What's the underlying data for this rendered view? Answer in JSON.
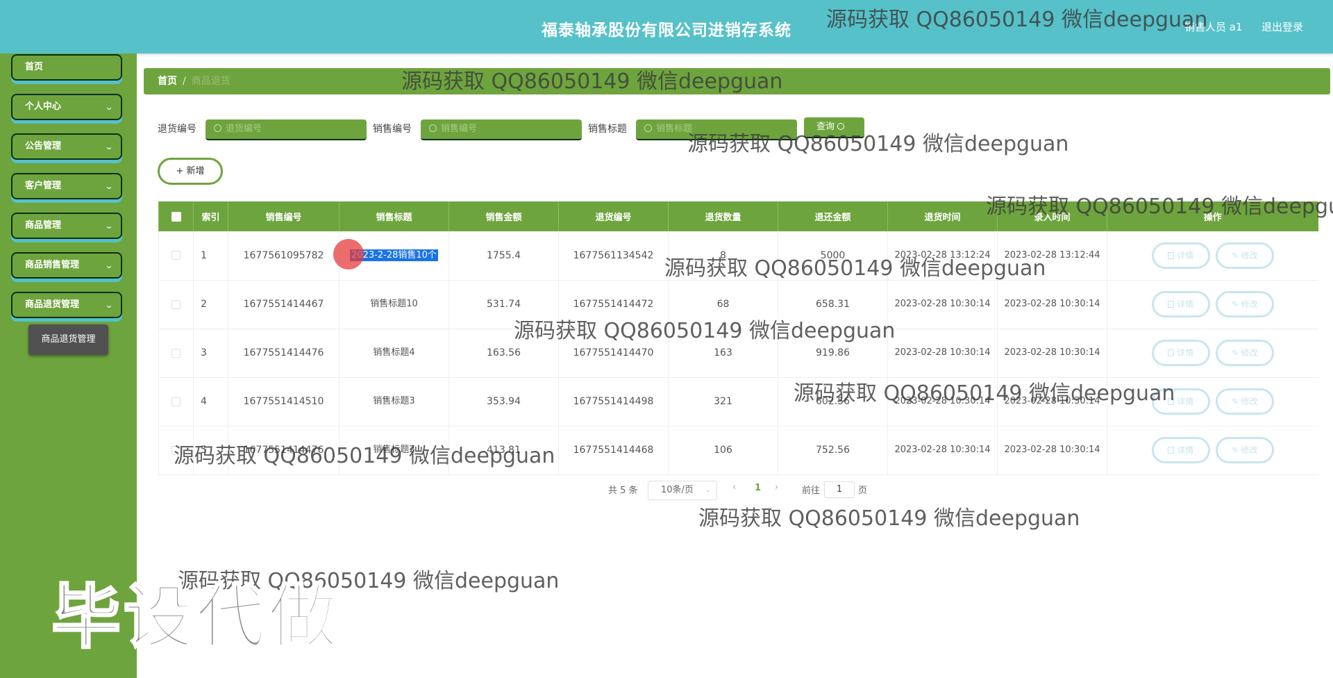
{
  "header": {
    "title": "福泰轴承股份有限公司进销存系统",
    "user_label": "销售人员 a1",
    "logout_label": "退出登录"
  },
  "sidebar": {
    "items": [
      {
        "label": "首页",
        "has_arrow": false
      },
      {
        "label": "个人中心",
        "has_arrow": true
      },
      {
        "label": "公告管理",
        "has_arrow": true
      },
      {
        "label": "客户管理",
        "has_arrow": true
      },
      {
        "label": "商品管理",
        "has_arrow": true
      },
      {
        "label": "商品销售管理",
        "has_arrow": true
      },
      {
        "label": "商品退货管理",
        "has_arrow": true
      }
    ],
    "submenu_active": "商品退货管理"
  },
  "breadcrumb": {
    "home": "首页",
    "separator": "/",
    "current": "商品退货"
  },
  "search": {
    "fields": [
      {
        "label": "退货编号",
        "placeholder": "退货编号"
      },
      {
        "label": "销售编号",
        "placeholder": "销售编号"
      },
      {
        "label": "销售标题",
        "placeholder": "销售标题"
      }
    ],
    "query_label": "查询",
    "add_label": "+ 新增"
  },
  "table": {
    "columns": [
      "索引",
      "销售编号",
      "销售标题",
      "销售金额",
      "退货编号",
      "退货数量",
      "退还金额",
      "退货时间",
      "录入时间",
      "操作"
    ],
    "rows": [
      {
        "index": "1",
        "sale_no": "1677561095782",
        "title": "2023-2-28销售10个",
        "amount": "1755.4",
        "return_no": "1677561134542",
        "qty": "8",
        "refund": "5000",
        "return_time": "2023-02-28 13:12:24",
        "entry_time": "2023-02-28 13:12:44"
      },
      {
        "index": "2",
        "sale_no": "1677551414467",
        "title": "销售标题10",
        "amount": "531.74",
        "return_no": "1677551414472",
        "qty": "68",
        "refund": "658.31",
        "return_time": "2023-02-28 10:30:14",
        "entry_time": "2023-02-28 10:30:14"
      },
      {
        "index": "3",
        "sale_no": "1677551414476",
        "title": "销售标题4",
        "amount": "163.56",
        "return_no": "1677551414470",
        "qty": "163",
        "refund": "919.86",
        "return_time": "2023-02-28 10:30:14",
        "entry_time": "2023-02-28 10:30:14"
      },
      {
        "index": "4",
        "sale_no": "1677551414510",
        "title": "销售标题3",
        "amount": "353.94",
        "return_no": "1677551414498",
        "qty": "321",
        "refund": "602.56",
        "return_time": "2023-02-28 10:30:14",
        "entry_time": "2023-02-28 10:30:14"
      },
      {
        "index": "5",
        "sale_no": "1677551414476",
        "title": "销售标题2",
        "amount": "413.81",
        "return_no": "1677551414468",
        "qty": "106",
        "refund": "752.56",
        "return_time": "2023-02-28 10:30:14",
        "entry_time": "2023-02-28 10:30:14"
      }
    ],
    "detail_label": "详情",
    "edit_label": "修改"
  },
  "pagination": {
    "total": "共 5 条",
    "page_size": "10条/页",
    "current_page": "1",
    "goto_prefix": "前往",
    "goto_value": "1",
    "goto_suffix": "页"
  },
  "watermarks": {
    "text": "源码获取 QQ86050149 微信deepguan",
    "text_cut": "源码获取 QQ86050149 微信deepgu",
    "big_text": "毕设代做"
  }
}
